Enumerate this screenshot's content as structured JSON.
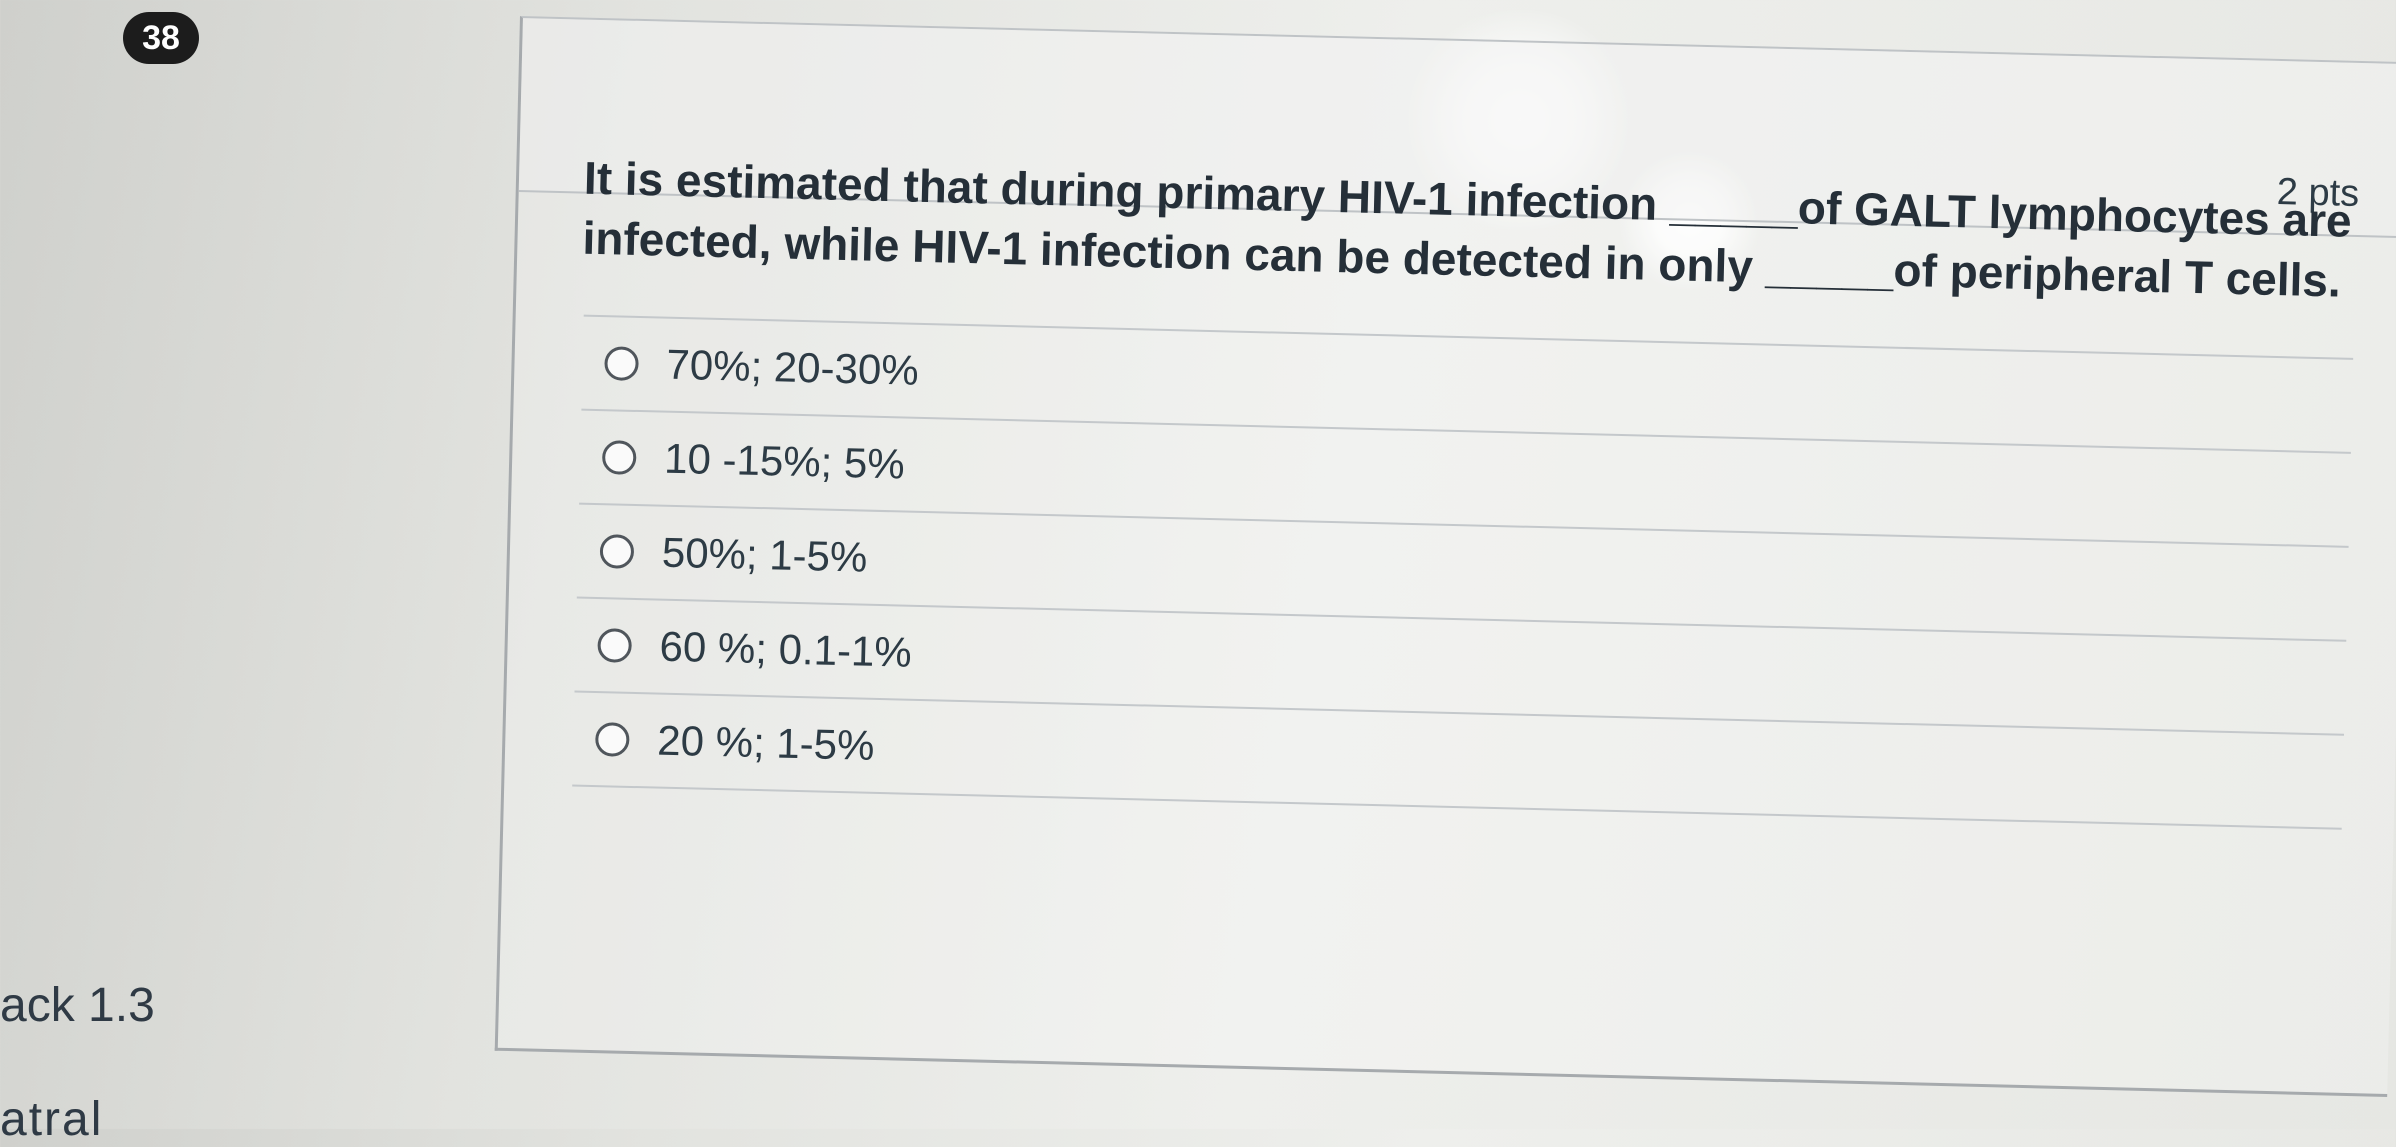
{
  "question": {
    "number": "38",
    "points": "2 pts",
    "text": "It is estimated that during primary HIV-1 infection _____of GALT lymphocytes are infected, while HIV-1 infection can be detected in only _____of peripheral T cells.",
    "answers": [
      "70%; 20-30%",
      "10 -15%; 5%",
      "50%; 1-5%",
      "60 %; 0.1-1%",
      "20 %; 1-5%"
    ]
  },
  "sidebar": {
    "partial_label": "ack 1.3",
    "partial_label_2": "atral"
  },
  "colors": {
    "badge": "#1c1c1c",
    "text": "#2d3b45",
    "divider": "#c4c8cb"
  }
}
